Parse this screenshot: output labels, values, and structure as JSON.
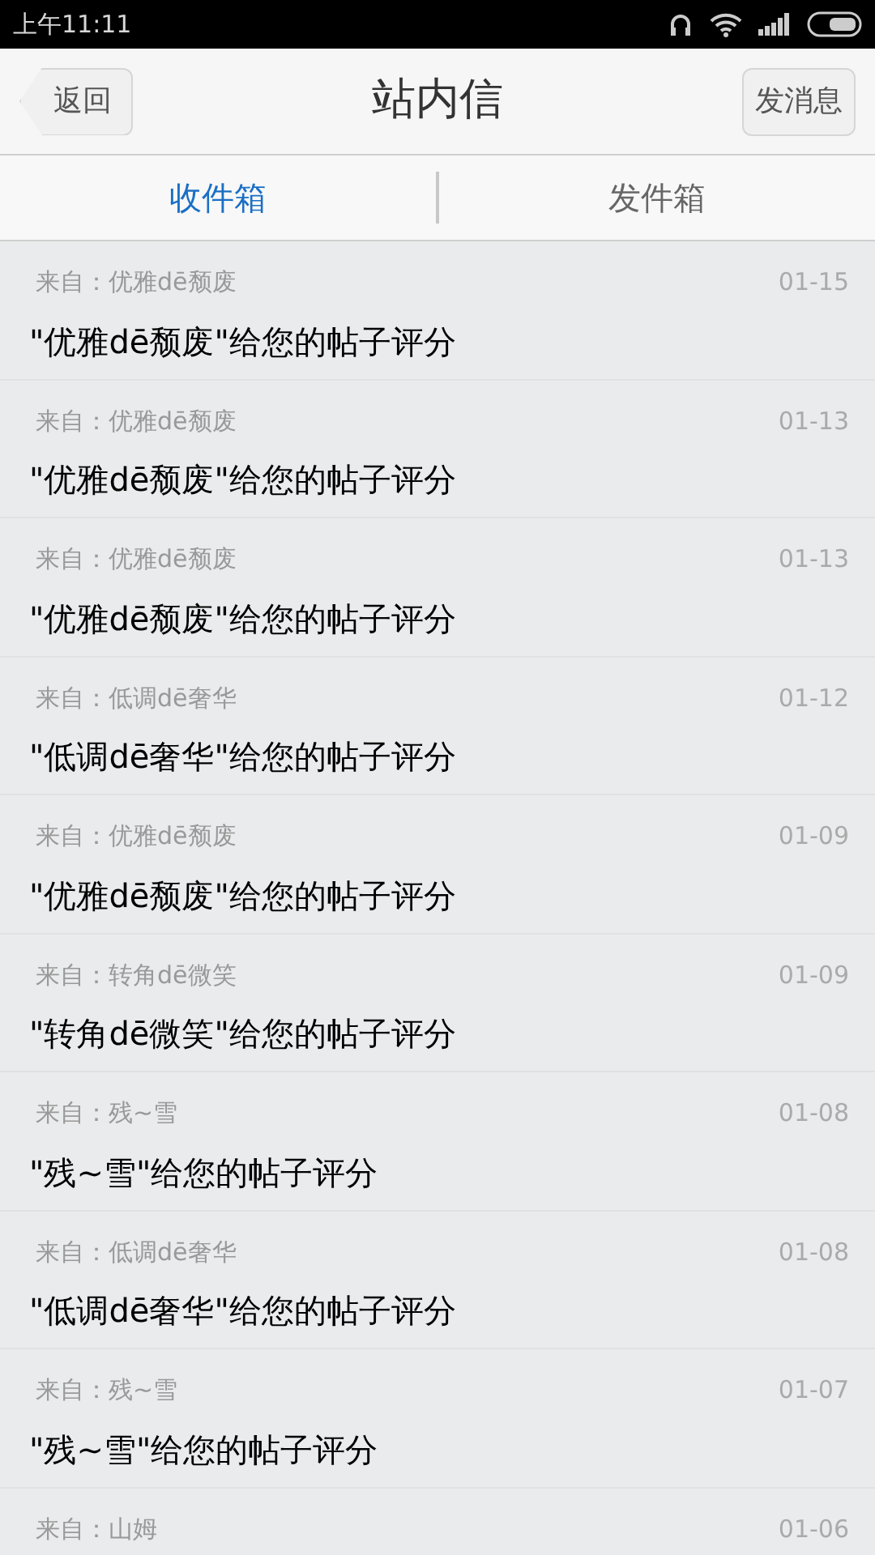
{
  "status_bar": {
    "time": "上午11:11"
  },
  "header": {
    "back": "返回",
    "title": "站内信",
    "action": "发消息"
  },
  "tabs": [
    {
      "label": "收件箱",
      "selected": true
    },
    {
      "label": "发件箱",
      "selected": false
    }
  ],
  "messages": [
    {
      "from": "来自：优雅dē颓废",
      "date": "01-15",
      "subject": "\"优雅dē颓废\"给您的帖子评分"
    },
    {
      "from": "来自：优雅dē颓废",
      "date": "01-13",
      "subject": "\"优雅dē颓废\"给您的帖子评分"
    },
    {
      "from": "来自：优雅dē颓废",
      "date": "01-13",
      "subject": "\"优雅dē颓废\"给您的帖子评分"
    },
    {
      "from": "来自：低调dē奢华",
      "date": "01-12",
      "subject": "\"低调dē奢华\"给您的帖子评分"
    },
    {
      "from": "来自：优雅dē颓废",
      "date": "01-09",
      "subject": "\"优雅dē颓废\"给您的帖子评分"
    },
    {
      "from": "来自：转角dē微笑",
      "date": "01-09",
      "subject": "\"转角dē微笑\"给您的帖子评分"
    },
    {
      "from": "来自：残~雪",
      "date": "01-08",
      "subject": "\"残~雪\"给您的帖子评分"
    },
    {
      "from": "来自：低调dē奢华",
      "date": "01-08",
      "subject": "\"低调dē奢华\"给您的帖子评分"
    },
    {
      "from": "来自：残~雪",
      "date": "01-07",
      "subject": "\"残~雪\"给您的帖子评分"
    },
    {
      "from": "来自：山姆",
      "date": "01-06"
    }
  ]
}
